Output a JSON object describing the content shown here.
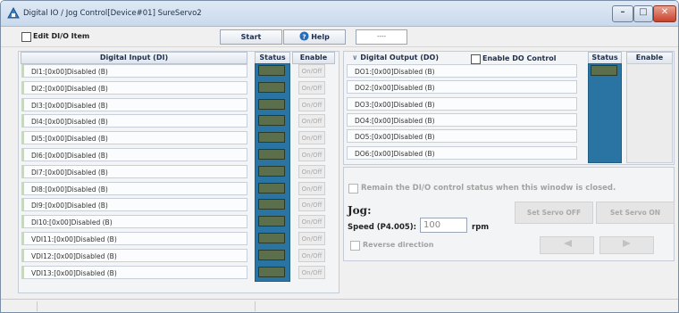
{
  "window": {
    "title": "Digital IO / Jog Control[Device#01] SureServo2",
    "minimize_symbol": "–",
    "maximize_symbol": "□",
    "close_symbol": "✕"
  },
  "toolbar": {
    "edit_label": "Edit DI/O Item",
    "start_label": "Start",
    "help_label": "Help",
    "field_value": "----"
  },
  "di": {
    "header": "Digital Input (DI)",
    "status_header": "Status",
    "enable_header": "Enable",
    "onoff_label": "On/Off",
    "items": [
      "DI1:[0x00]Disabled (B)",
      "DI2:[0x00]Disabled (B)",
      "DI3:[0x00]Disabled (B)",
      "DI4:[0x00]Disabled (B)",
      "DI5:[0x00]Disabled (B)",
      "DI6:[0x00]Disabled (B)",
      "DI7:[0x00]Disabled (B)",
      "DI8:[0x00]Disabled (B)",
      "DI9:[0x00]Disabled (B)",
      "DI10:[0x00]Disabled (B)",
      "VDI11:[0x00]Disabled (B)",
      "VDI12:[0x00]Disabled (B)",
      "VDI13:[0x00]Disabled (B)"
    ]
  },
  "do": {
    "header": "Digital Output (DO)",
    "enable_control_label": "Enable DO Control",
    "status_header": "Status",
    "enable_header": "Enable",
    "items": [
      "DO1:[0x00]Disabled (B)",
      "DO2:[0x00]Disabled (B)",
      "DO3:[0x00]Disabled (B)",
      "DO4:[0x00]Disabled (B)",
      "DO5:[0x00]Disabled (B)",
      "DO6:[0x00]Disabled (B)"
    ]
  },
  "remain_label": "Remain the DI/O control status when this winodw is closed.",
  "jog": {
    "title": "Jog:",
    "speed_label": "Speed (P4.005):",
    "speed_value": "100",
    "unit": "rpm",
    "reverse_label": "Reverse direction",
    "servo_off_label": "Set Servo OFF",
    "servo_on_label": "Set Servo ON"
  },
  "colors": {
    "status_column": "#2a74a4",
    "led_off": "#5b6f4c",
    "accent": "#1a2d58"
  }
}
